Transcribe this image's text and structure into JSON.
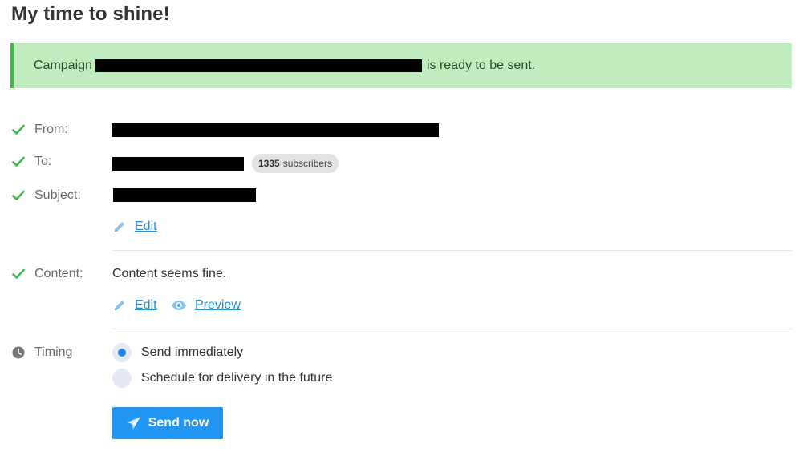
{
  "page": {
    "title": "My time to shine!"
  },
  "banner": {
    "prefix": "Campaign",
    "suffix": "is ready to be sent."
  },
  "details": {
    "from_label": "From:",
    "to_label": "To:",
    "subscriber_count": "1335",
    "subscriber_word": "subscribers",
    "subject_label": "Subject:",
    "edit_label": "Edit"
  },
  "content": {
    "label": "Content:",
    "status": "Content seems fine.",
    "edit_label": "Edit",
    "preview_label": "Preview"
  },
  "timing": {
    "label": "Timing",
    "options": [
      {
        "label": "Send immediately",
        "selected": true
      },
      {
        "label": "Schedule for delivery in the future",
        "selected": false
      }
    ]
  },
  "actions": {
    "send_label": "Send now"
  },
  "colors": {
    "success": "#3fb94a",
    "banner_bg": "#bfedc0",
    "link": "#1f8fd6",
    "primary": "#2196f3",
    "redaction": "#000000"
  },
  "icons": {
    "check": "check-icon",
    "pencil": "pencil-icon",
    "eye": "eye-icon",
    "clock": "clock-icon",
    "send": "paper-plane-icon"
  }
}
